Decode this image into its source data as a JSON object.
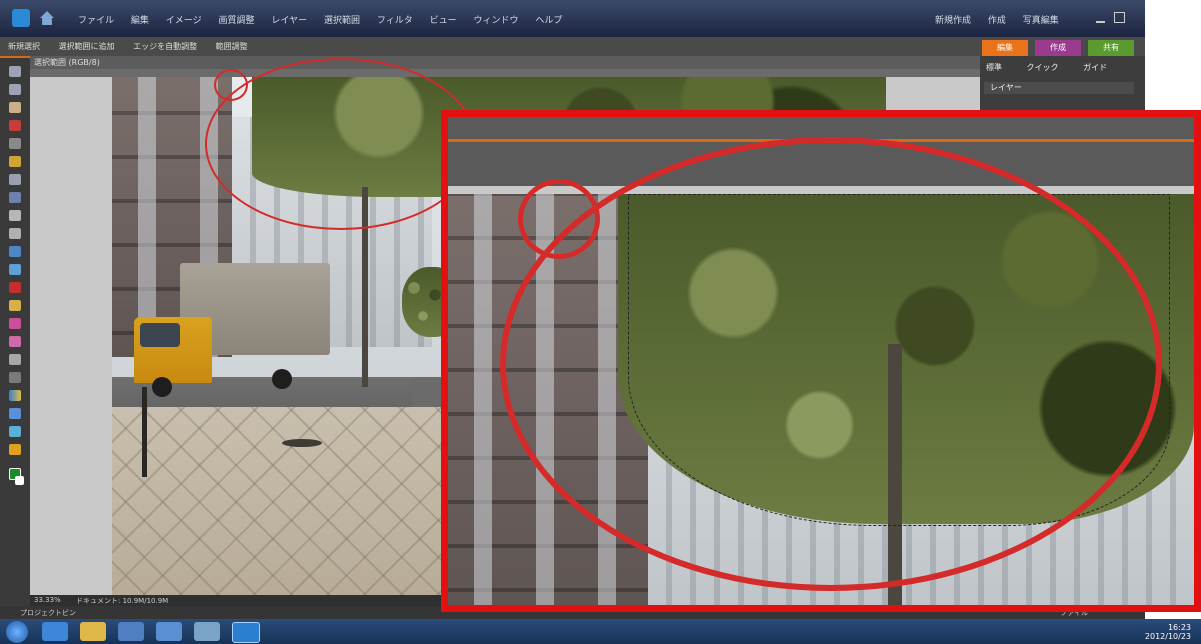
{
  "menubar": {
    "items": [
      "ファイル",
      "編集",
      "イメージ",
      "画質調整",
      "レイヤー",
      "選択範囲",
      "フィルタ",
      "ビュー",
      "ウィンドウ",
      "ヘルプ"
    ],
    "right_items": [
      "新規作成",
      "作成",
      "写真編集"
    ]
  },
  "options_bar": {
    "items": [
      "新規選択",
      "選択範囲に追加",
      "エッジを自動調整",
      "範囲調整"
    ]
  },
  "document_tab": {
    "title": "選択範囲 (RGB/8)"
  },
  "right_panel": {
    "tabs": [
      {
        "label": "編集",
        "color": "#e9731a"
      },
      {
        "label": "作成",
        "color": "#9b3b8f"
      },
      {
        "label": "共有",
        "color": "#5a9a2e"
      }
    ],
    "modes": [
      "標準",
      "クイック",
      "ガイド"
    ],
    "section": "レイヤー"
  },
  "status_bar": {
    "zoom": "33.33%",
    "info": "ドキュメント: 10.9M/10.9M"
  },
  "bottom_bar": {
    "left": "プロジェクトビン",
    "right": "ファイル"
  },
  "taskbar": {
    "time": "16:23",
    "date": "2012/10/23"
  },
  "annotation": {
    "ellipse_color": "#d42a2a",
    "frame_color": "#e21010"
  }
}
